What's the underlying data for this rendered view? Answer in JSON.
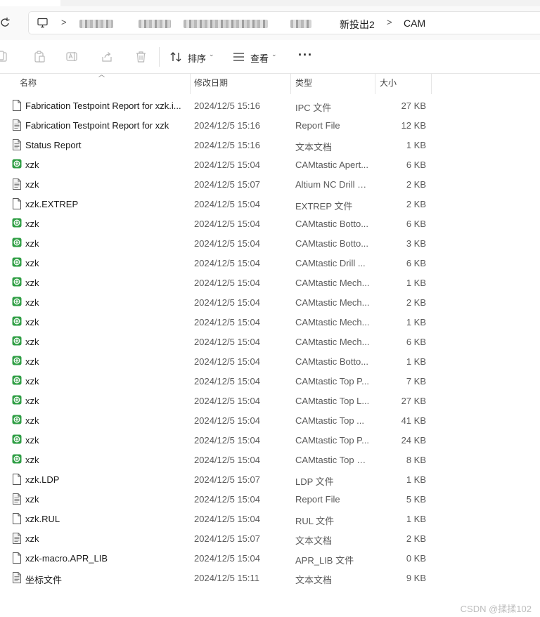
{
  "breadcrumb": {
    "separator": ">",
    "parent_folder": "新投出2",
    "current_folder": "CAM"
  },
  "toolbar": {
    "sort_label": "排序",
    "view_label": "查看",
    "more_label": "···"
  },
  "columns": {
    "name": "名称",
    "date": "修改日期",
    "type": "类型",
    "size": "大小"
  },
  "files": [
    {
      "name": "Fabrication Testpoint Report for xzk.ipc",
      "display_name": "Fabrication Testpoint Report for xzk.i...",
      "date": "2024/12/5 15:16",
      "type": "IPC 文件",
      "size": "27 KB",
      "icon": "blank-file-icon"
    },
    {
      "name": "Fabrication Testpoint Report for xzk",
      "date": "2024/12/5 15:16",
      "type": "Report File",
      "size": "12 KB",
      "icon": "text-file-icon"
    },
    {
      "name": "Status Report",
      "date": "2024/12/5 15:16",
      "type": "文本文档",
      "size": "1 KB",
      "icon": "text-file-icon"
    },
    {
      "name": "xzk",
      "date": "2024/12/5 15:04",
      "type": "CAMtastic Apert...",
      "size": "6 KB",
      "icon": "camtastic-icon"
    },
    {
      "name": "xzk",
      "date": "2024/12/5 15:07",
      "type": "Altium NC Drill R...",
      "size": "2 KB",
      "icon": "text-file-icon"
    },
    {
      "name": "xzk.EXTREP",
      "date": "2024/12/5 15:04",
      "type": "EXTREP 文件",
      "size": "2 KB",
      "icon": "blank-file-icon"
    },
    {
      "name": "xzk",
      "date": "2024/12/5 15:04",
      "type": "CAMtastic Botto...",
      "size": "6 KB",
      "icon": "camtastic-icon"
    },
    {
      "name": "xzk",
      "date": "2024/12/5 15:04",
      "type": "CAMtastic Botto...",
      "size": "3 KB",
      "icon": "camtastic-icon"
    },
    {
      "name": "xzk",
      "date": "2024/12/5 15:04",
      "type": "CAMtastic Drill ...",
      "size": "6 KB",
      "icon": "camtastic-icon"
    },
    {
      "name": "xzk",
      "date": "2024/12/5 15:04",
      "type": "CAMtastic Mech...",
      "size": "1 KB",
      "icon": "camtastic-icon"
    },
    {
      "name": "xzk",
      "date": "2024/12/5 15:04",
      "type": "CAMtastic Mech...",
      "size": "2 KB",
      "icon": "camtastic-icon"
    },
    {
      "name": "xzk",
      "date": "2024/12/5 15:04",
      "type": "CAMtastic Mech...",
      "size": "1 KB",
      "icon": "camtastic-icon"
    },
    {
      "name": "xzk",
      "date": "2024/12/5 15:04",
      "type": "CAMtastic Mech...",
      "size": "6 KB",
      "icon": "camtastic-icon"
    },
    {
      "name": "xzk",
      "date": "2024/12/5 15:04",
      "type": "CAMtastic Botto...",
      "size": "1 KB",
      "icon": "camtastic-icon"
    },
    {
      "name": "xzk",
      "date": "2024/12/5 15:04",
      "type": "CAMtastic Top P...",
      "size": "7 KB",
      "icon": "camtastic-icon"
    },
    {
      "name": "xzk",
      "date": "2024/12/5 15:04",
      "type": "CAMtastic Top L...",
      "size": "27 KB",
      "icon": "camtastic-icon"
    },
    {
      "name": "xzk",
      "date": "2024/12/5 15:04",
      "type": "CAMtastic Top ...",
      "size": "41 KB",
      "icon": "camtastic-icon"
    },
    {
      "name": "xzk",
      "date": "2024/12/5 15:04",
      "type": "CAMtastic Top P...",
      "size": "24 KB",
      "icon": "camtastic-icon"
    },
    {
      "name": "xzk",
      "date": "2024/12/5 15:04",
      "type": "CAMtastic Top S...",
      "size": "8 KB",
      "icon": "camtastic-icon"
    },
    {
      "name": "xzk.LDP",
      "date": "2024/12/5 15:07",
      "type": "LDP 文件",
      "size": "1 KB",
      "icon": "blank-file-icon"
    },
    {
      "name": "xzk",
      "date": "2024/12/5 15:04",
      "type": "Report File",
      "size": "5 KB",
      "icon": "text-file-icon"
    },
    {
      "name": "xzk.RUL",
      "date": "2024/12/5 15:04",
      "type": "RUL 文件",
      "size": "1 KB",
      "icon": "blank-file-icon"
    },
    {
      "name": "xzk",
      "date": "2024/12/5 15:07",
      "type": "文本文档",
      "size": "2 KB",
      "icon": "text-file-icon"
    },
    {
      "name": "xzk-macro.APR_LIB",
      "date": "2024/12/5 15:04",
      "type": "APR_LIB 文件",
      "size": "0 KB",
      "icon": "blank-file-icon"
    },
    {
      "name": "坐标文件",
      "date": "2024/12/5 15:11",
      "type": "文本文档",
      "size": "9 KB",
      "icon": "text-file-icon"
    }
  ],
  "watermark": "CSDN @揉揉102",
  "colors": {
    "camtastic_green": "#2f9e44",
    "background": "#ffffff",
    "secondary_text": "#5a5a5a"
  }
}
